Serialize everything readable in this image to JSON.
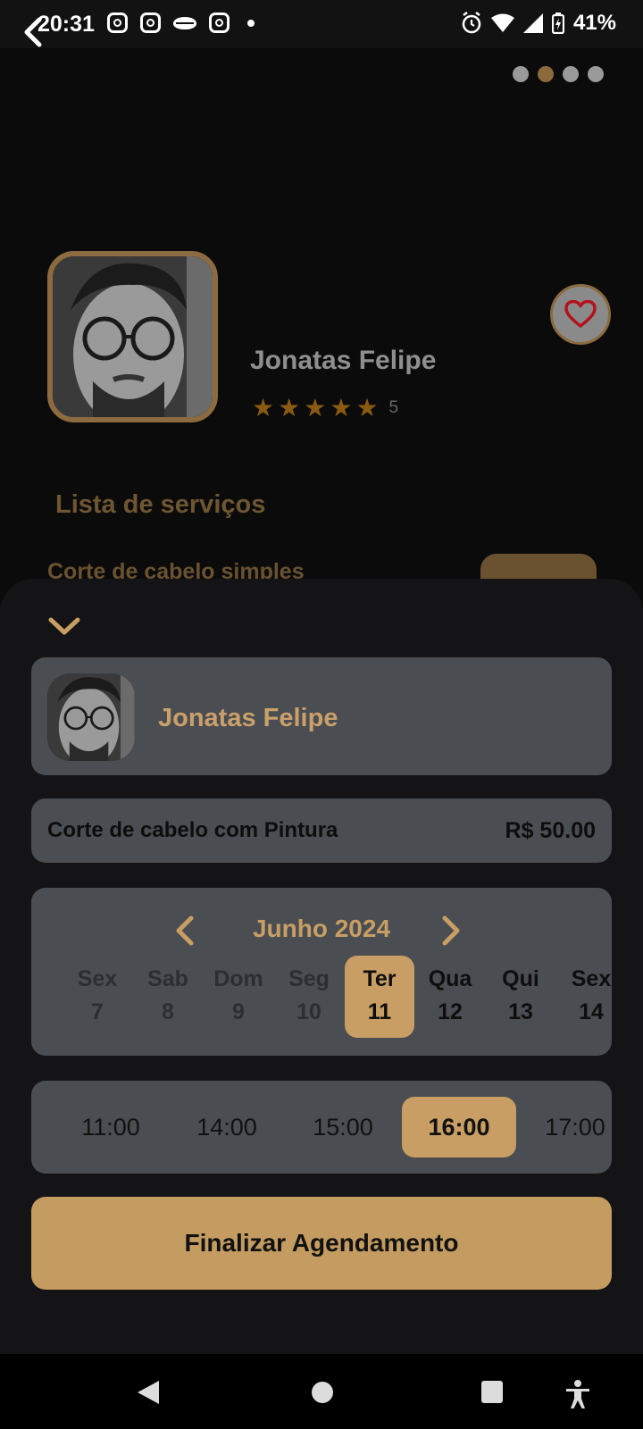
{
  "status_bar": {
    "time": "20:31",
    "battery": "41%"
  },
  "carousel": {
    "dot_count": 4,
    "active_index": 1
  },
  "profile": {
    "name": "Jonatas Felipe",
    "rating_stars": 5,
    "rating_value": "5"
  },
  "services": {
    "title": "Lista de serviços",
    "first_item": "Corte de cabelo simples"
  },
  "booking": {
    "barber_name": "Jonatas Felipe",
    "service_name": "Corte de cabelo com Pintura",
    "service_price": "R$ 50.00",
    "calendar": {
      "month": "Junho 2024",
      "days": [
        {
          "name": "Sex",
          "num": "7"
        },
        {
          "name": "Sab",
          "num": "8"
        },
        {
          "name": "Dom",
          "num": "9"
        },
        {
          "name": "Seg",
          "num": "10"
        },
        {
          "name": "Ter",
          "num": "11"
        },
        {
          "name": "Qua",
          "num": "12"
        },
        {
          "name": "Qui",
          "num": "13"
        },
        {
          "name": "Sex",
          "num": "14"
        }
      ],
      "selected_index": 4
    },
    "times": [
      "11:00",
      "14:00",
      "15:00",
      "16:00",
      "17:00"
    ],
    "selected_time_index": 3,
    "finish_label": "Finalizar Agendamento"
  },
  "colors": {
    "accent": "#c89e64",
    "card_bg": "#4a4d52",
    "sheet_bg": "#141416",
    "favorite_heart": "#b3121b"
  },
  "icons": {
    "back": "back-arrow-icon",
    "favorite": "heart-icon",
    "collapse": "chevron-down-icon",
    "calendar_prev": "chevron-left-icon",
    "calendar_next": "chevron-right-icon"
  }
}
